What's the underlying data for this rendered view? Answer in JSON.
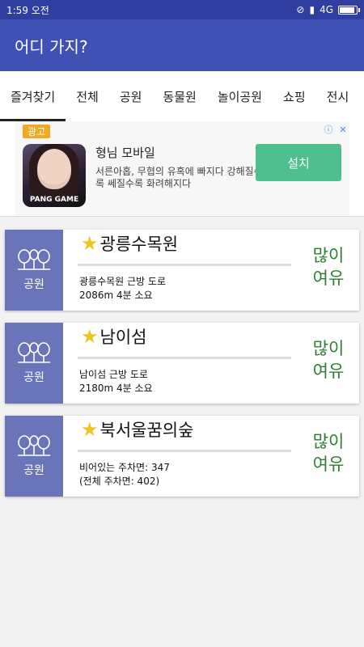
{
  "statusbar": {
    "time": "1:59 오전",
    "network": "4G"
  },
  "appbar": {
    "title": "어디 가지?"
  },
  "tabs": [
    {
      "label": "즐겨찾기"
    },
    {
      "label": "전체"
    },
    {
      "label": "공원"
    },
    {
      "label": "동물원"
    },
    {
      "label": "놀이공원"
    },
    {
      "label": "쇼핑"
    },
    {
      "label": "전시"
    }
  ],
  "ad": {
    "badge": "광고",
    "title": "형님 모바일",
    "desc": "서른아홉, 무협의 유혹에 빠지다 강해질수록 쎄질수록 화려해지다",
    "install": "설치",
    "image_label": "PANG GAME"
  },
  "cards": [
    {
      "category": "공원",
      "title": "광릉수목원",
      "line1": "광릉수목원 근방 도로",
      "line2": "2086m 4분 소요",
      "status_top": "많이",
      "status_bottom": "여유",
      "progress": 0
    },
    {
      "category": "공원",
      "title": "남이섬",
      "line1": "남이섬 근방 도로",
      "line2": "2180m 4분 소요",
      "status_top": "많이",
      "status_bottom": "여유",
      "progress": 0
    },
    {
      "category": "공원",
      "title": "북서울꿈의숲",
      "line1": "비어있는 주차면: 347",
      "line2": "(전체 주차면: 402)",
      "status_top": "많이",
      "status_bottom": "여유",
      "progress": 0
    }
  ],
  "colors": {
    "primary": "#3f51b5",
    "primary_dark": "#303f9f",
    "category": "#6a74b8",
    "status_green": "#2e7d32",
    "install": "#4fc08d",
    "star": "#f0c420"
  }
}
